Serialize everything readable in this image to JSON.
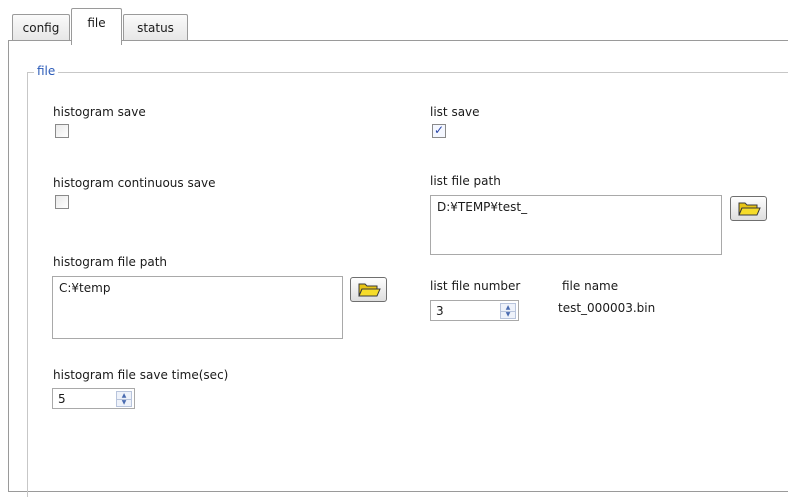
{
  "tabs": [
    {
      "label": "config"
    },
    {
      "label": "file"
    },
    {
      "label": "status"
    }
  ],
  "active_tab": "file",
  "group": {
    "title": "file"
  },
  "left": {
    "histogram_save": {
      "label": "histogram save",
      "checked": false
    },
    "histogram_continuous_save": {
      "label": "histogram continuous save",
      "checked": false
    },
    "histogram_file_path": {
      "label": "histogram file path",
      "value": "C:¥temp"
    },
    "histogram_save_time": {
      "label": "histogram file save time(sec)",
      "value": "5"
    }
  },
  "right": {
    "list_save": {
      "label": "list save",
      "checked": true
    },
    "list_file_path": {
      "label": "list file path",
      "value": "D:¥TEMP¥test_"
    },
    "list_file_number": {
      "label": "list file number",
      "value": "3"
    },
    "file_name": {
      "label": "file name",
      "value": "test_000003.bin"
    }
  },
  "icons": {
    "browse": "folder-open-icon",
    "spinner": "up-down-arrows-icon",
    "check": "checkmark-icon"
  },
  "colors": {
    "group_title": "#2a5ab8",
    "folder": "#f2d21c",
    "checkmark": "#2a46a8"
  }
}
